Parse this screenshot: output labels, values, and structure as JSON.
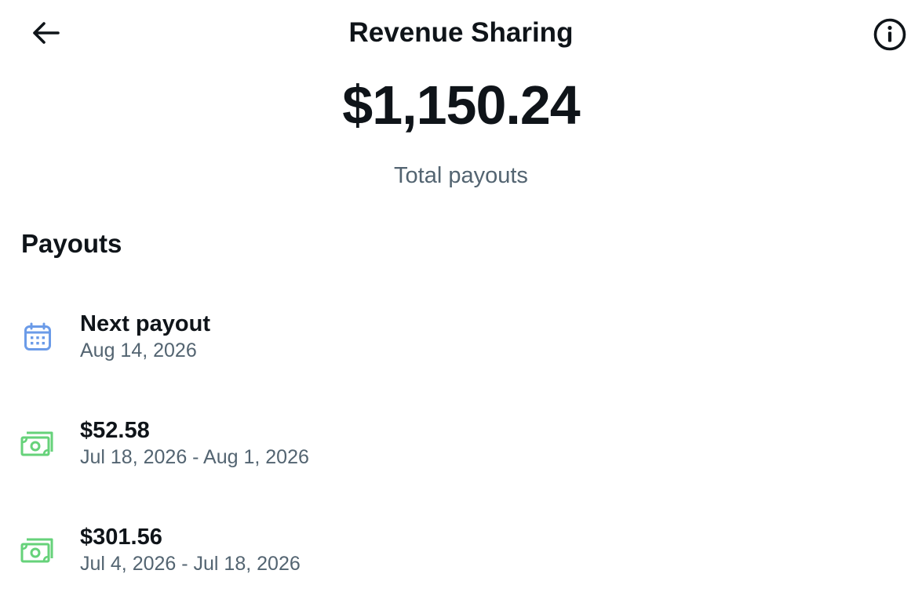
{
  "header": {
    "title": "Revenue Sharing",
    "back_icon": "arrow-left-icon",
    "info_icon": "info-circle-icon"
  },
  "summary": {
    "total_amount": "$1,150.24",
    "total_label": "Total payouts"
  },
  "payouts": {
    "section_title": "Payouts",
    "items": [
      {
        "icon": "calendar-icon",
        "icon_color": "#6b9be8",
        "primary": "Next payout",
        "secondary": "Aug 14, 2026"
      },
      {
        "icon": "money-icon",
        "icon_color": "#66d27a",
        "primary": "$52.58",
        "secondary": "Jul 18, 2026 - Aug 1, 2026"
      },
      {
        "icon": "money-icon",
        "icon_color": "#66d27a",
        "primary": "$301.56",
        "secondary": "Jul 4, 2026 - Jul 18, 2026"
      }
    ]
  }
}
